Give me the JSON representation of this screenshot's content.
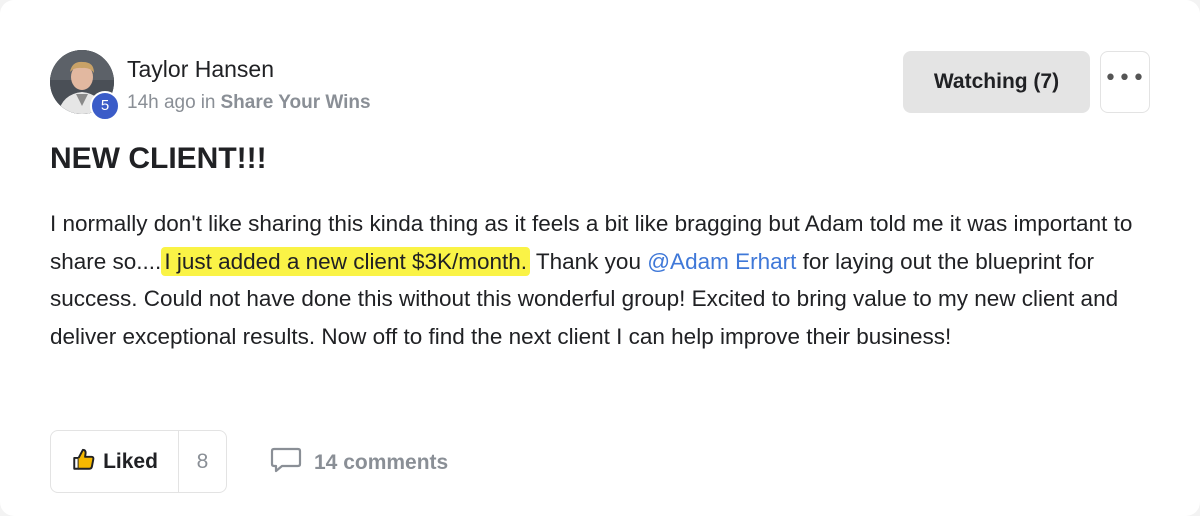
{
  "post": {
    "author": "Taylor Hansen",
    "level": "5",
    "time_ago": "14h ago",
    "in_text": "in",
    "category": "Share Your Wins",
    "title": "NEW CLIENT!!!",
    "body_part1": "I normally don't like sharing this kinda thing as it feels a bit like bragging but Adam told me it was important to share so....",
    "body_highlight": "I just added a new client $3K/month.",
    "body_part2": " Thank you ",
    "mention": "@Adam Erhart",
    "body_part3": " for laying out the blueprint for success. Could not have done this without this wonderful group! Excited to bring value to my new client and deliver exceptional results. Now off to find the next client I can help improve their business!"
  },
  "actions": {
    "watching_label": "Watching (7)",
    "more_label": "•••",
    "like_label": "Liked",
    "like_count": "8",
    "comments_label": "14 comments"
  },
  "colors": {
    "highlight": "#faf346",
    "mention": "#3f78d8",
    "level_badge": "#3b5cc8"
  },
  "icons": [
    "thumbs-up-icon",
    "comment-icon",
    "more-icon"
  ]
}
